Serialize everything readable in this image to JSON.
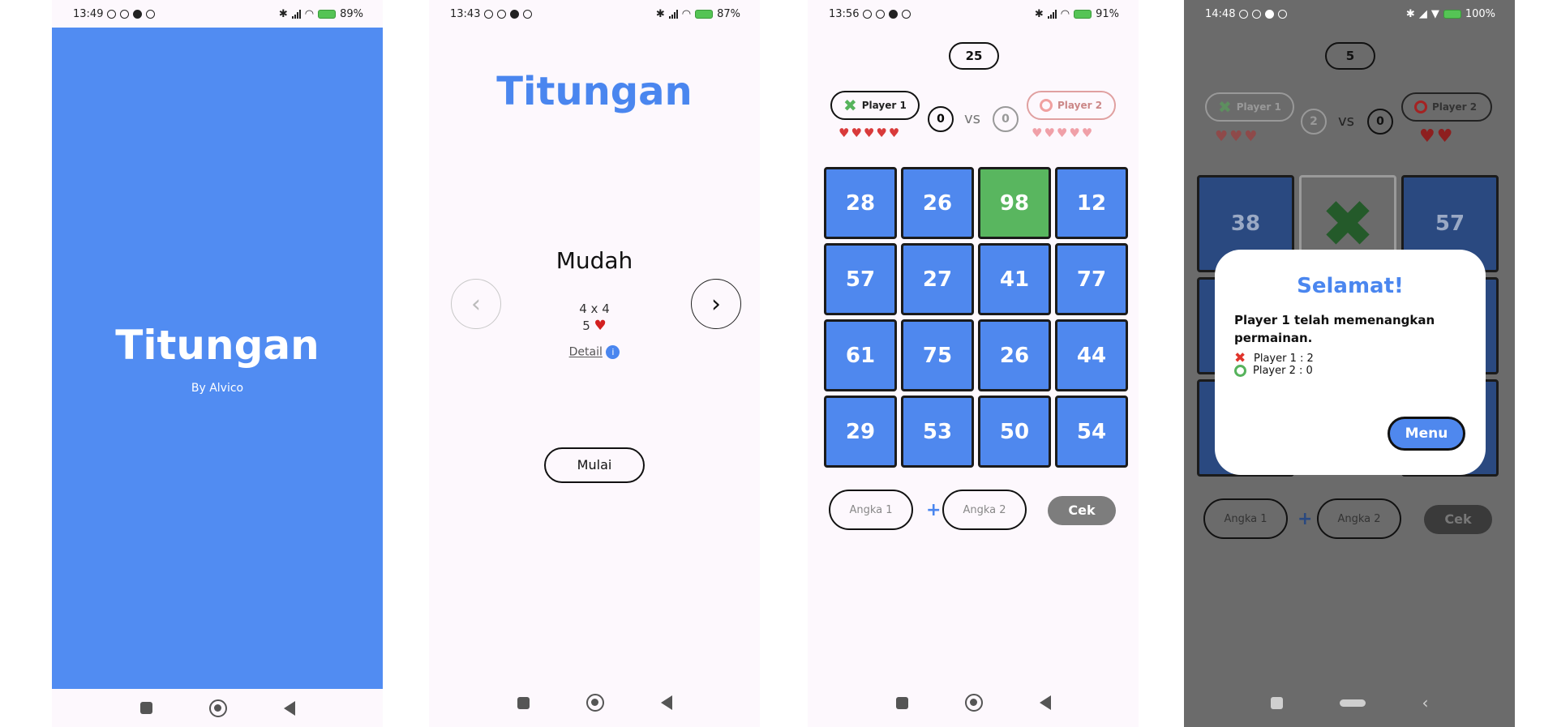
{
  "screens": {
    "splash": {
      "status": {
        "time": "13:49",
        "battery": "89%"
      },
      "title": "Titungan",
      "byline": "By Alvico"
    },
    "menu": {
      "status": {
        "time": "13:43",
        "battery": "87%"
      },
      "title": "Titungan",
      "level": "Mudah",
      "grid_size": "4 x 4",
      "lives": "5",
      "detail_link": "Detail",
      "start_button": "Mulai"
    },
    "game": {
      "status": {
        "time": "13:56",
        "battery": "91%"
      },
      "timer": "25",
      "player1": {
        "name": "Player 1",
        "score": "0",
        "hearts": "♥♥♥♥♥"
      },
      "player2": {
        "name": "Player 2",
        "score": "0",
        "hearts": "♥♥♥♥♥"
      },
      "vs": "vs",
      "board": [
        "28",
        "26",
        "98",
        "12",
        "57",
        "27",
        "41",
        "77",
        "61",
        "75",
        "26",
        "44",
        "29",
        "53",
        "50",
        "54"
      ],
      "highlighted_cell": 2,
      "input1_placeholder": "Angka 1",
      "input2_placeholder": "Angka 2",
      "plus": "+",
      "check_button": "Cek"
    },
    "result": {
      "status": {
        "time": "14:48",
        "battery": "100%"
      },
      "timer": "5",
      "player1": {
        "name": "Player 1",
        "score": "2",
        "hearts": "♥♥♥"
      },
      "player2": {
        "name": "Player 2",
        "score": "0",
        "hearts": "♥♥"
      },
      "vs": "vs",
      "visible_cells": [
        "38",
        "57"
      ],
      "input1_placeholder": "Angka 1",
      "input2_placeholder": "Angka 2",
      "plus": "+",
      "check_button": "Cek",
      "dialog": {
        "title": "Selamat!",
        "message": "Player 1 telah memenangkan permainan.",
        "line1": "Player 1 : 2",
        "line2": "Player 2 : 0",
        "menu_button": "Menu"
      }
    }
  },
  "colors": {
    "primary": "#4f88ee",
    "success": "#59b65f",
    "heart": "#d93a3a",
    "dim_overlay": "#6b6b6b"
  }
}
